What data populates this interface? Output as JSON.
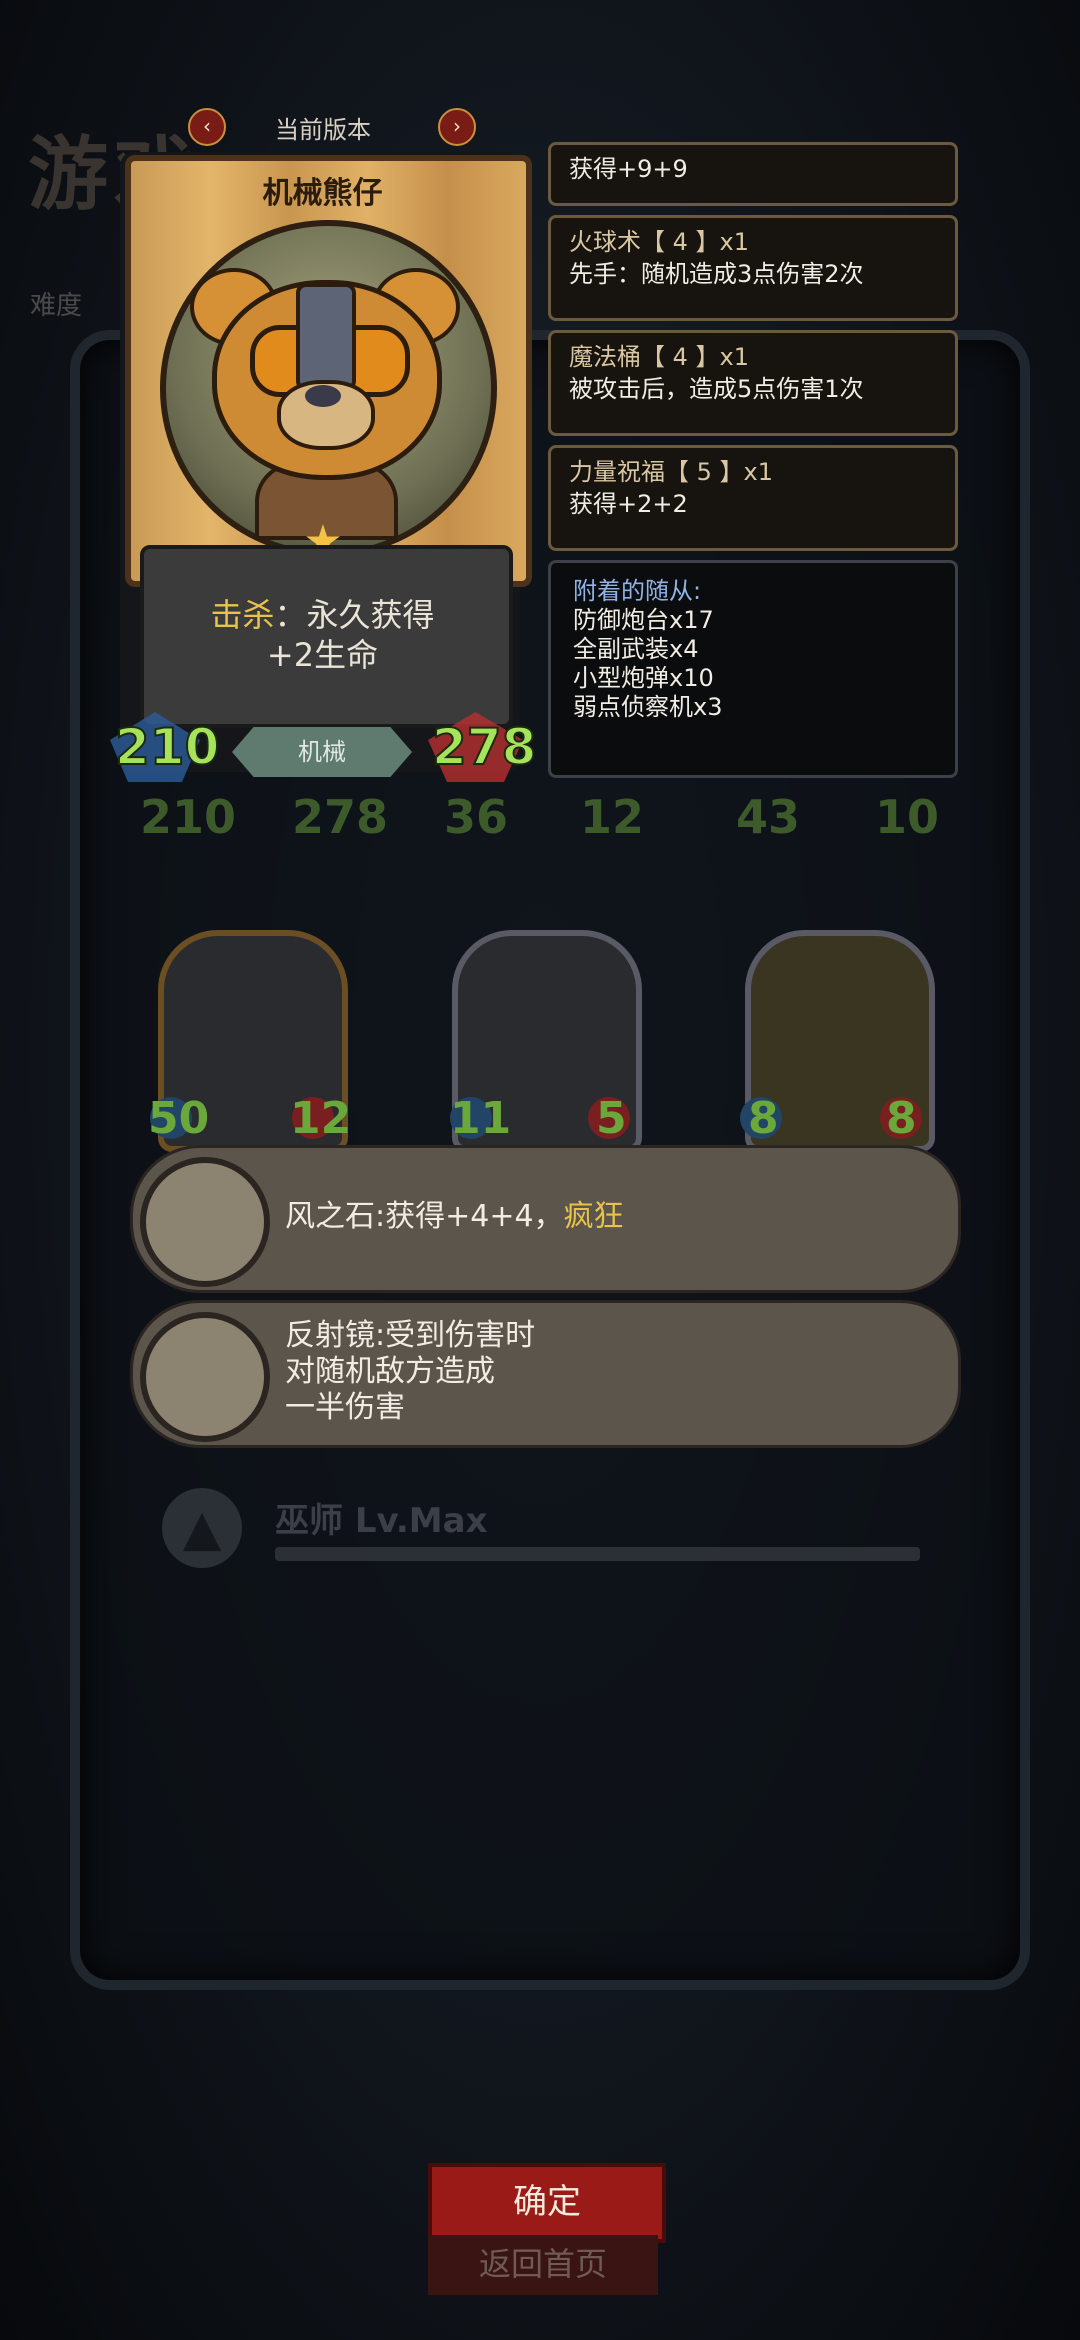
{
  "background": {
    "title": "游戏",
    "difficulty_label": "难度"
  },
  "version": {
    "label": "当前版本",
    "prev": "‹",
    "next": "›"
  },
  "hero": {
    "name": "机械熊仔",
    "effect_keyword": "击杀",
    "effect_rest": "：永久获得",
    "effect_line2": "+2生命",
    "attack": "210",
    "health": "278",
    "tribe": "机械"
  },
  "skills": [
    {
      "title": "",
      "desc": "获得+9+9"
    },
    {
      "title": "火球术【 4 】x1",
      "desc": "先手：随机造成3点伤害2次"
    },
    {
      "title": "魔法桶【 4 】x1",
      "desc": "被攻击后，造成5点伤害1次"
    },
    {
      "title": "力量祝福【 5 】x1",
      "desc": "获得+2+2"
    }
  ],
  "attached": {
    "title": "附着的随从:",
    "items": [
      "防御炮台x17",
      "全副武装x4",
      "小型炮弹x10",
      "弱点侦察机x3"
    ]
  },
  "board_row1": [
    {
      "atk": "210",
      "hp": "278"
    },
    {
      "atk": "36",
      "hp": "12"
    },
    {
      "atk": "43",
      "hp": "10"
    }
  ],
  "board_row2": [
    {
      "atk": "50",
      "hp": "12"
    },
    {
      "atk": "11",
      "hp": "5"
    },
    {
      "atk": "8",
      "hp": "8"
    }
  ],
  "relics": [
    {
      "text_main": "风之石:获得+4+4，",
      "text_kw": "疯狂",
      "icon": "wind-stone-icon"
    },
    {
      "line1": "反射镜:受到伤害时",
      "line2": "对随机敌方造成",
      "line3": "一半伤害",
      "icon": "mirror-icon"
    }
  ],
  "wizard": {
    "label": "巫师 Lv.Max",
    "progress": 1.0
  },
  "buttons": {
    "ok": "确定",
    "home": "返回首页"
  },
  "colors": {
    "accent_red": "#9a1a18",
    "keyword_yellow": "#e7c34b",
    "stat_green": "#a6e25a",
    "attached_title_blue": "#8fb3e6"
  }
}
